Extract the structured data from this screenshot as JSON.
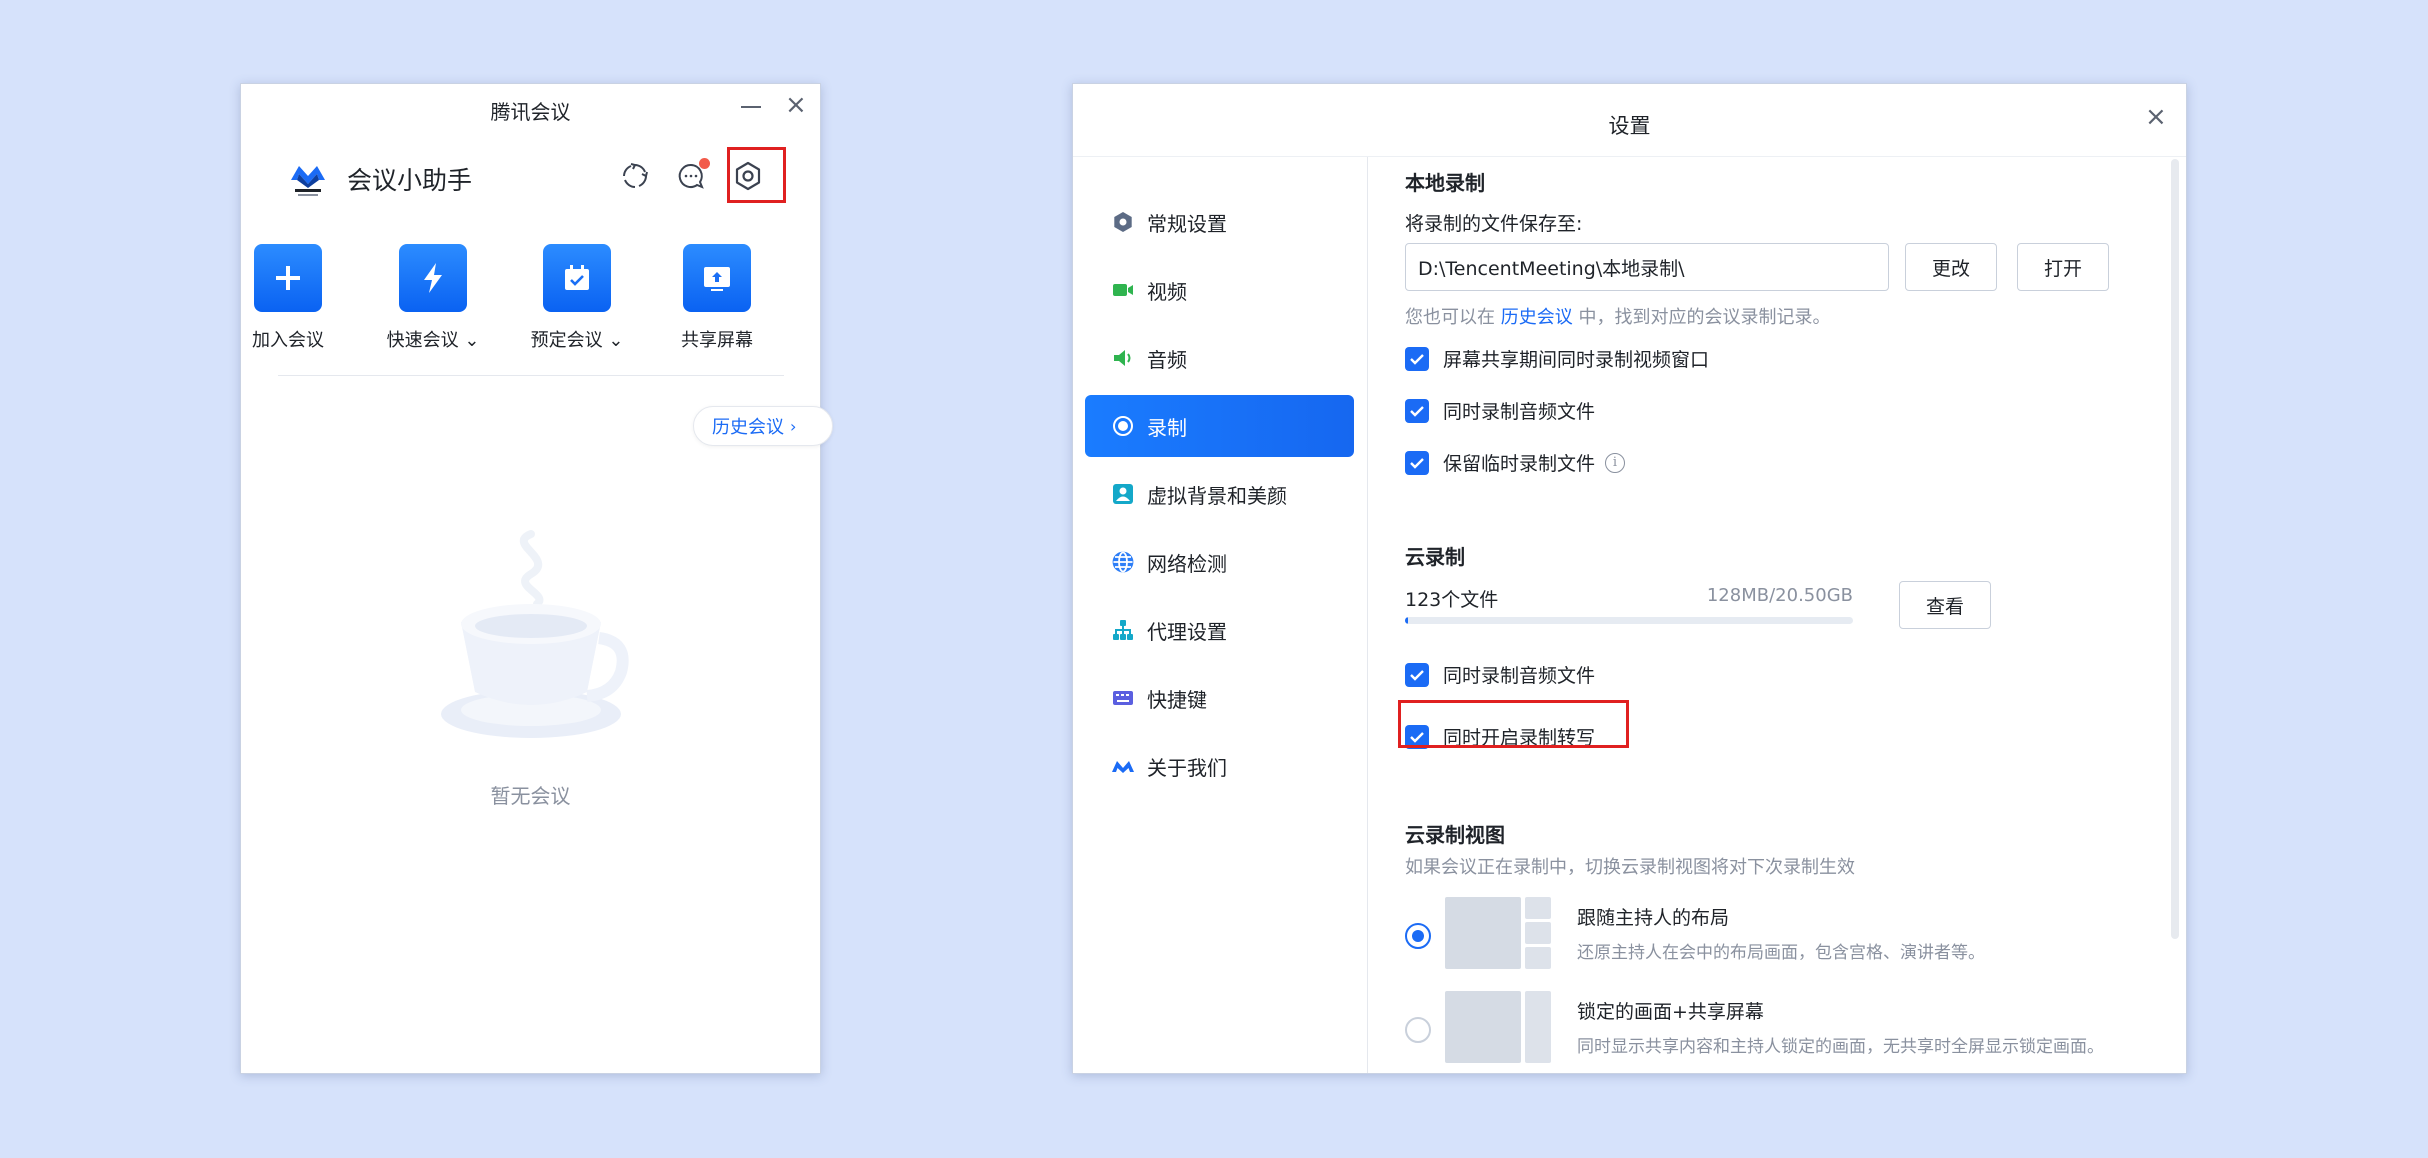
{
  "main_window": {
    "title": "腾讯会议",
    "brand_name": "会议小助手",
    "actions": [
      {
        "label": "加入会议",
        "icon": "plus-icon"
      },
      {
        "label": "快速会议",
        "icon": "lightning-icon",
        "dropdown": true
      },
      {
        "label": "预定会议",
        "icon": "calendar-icon",
        "dropdown": true
      },
      {
        "label": "共享屏幕",
        "icon": "share-screen-icon"
      }
    ],
    "history_button": "历史会议",
    "empty_text": "暂无会议"
  },
  "settings_window": {
    "title": "设置",
    "nav": [
      {
        "label": "常规设置",
        "icon": "gear-icon"
      },
      {
        "label": "视频",
        "icon": "camera-icon"
      },
      {
        "label": "音频",
        "icon": "speaker-icon"
      },
      {
        "label": "录制",
        "icon": "record-icon",
        "active": true
      },
      {
        "label": "虚拟背景和美颜",
        "icon": "portrait-icon"
      },
      {
        "label": "网络检测",
        "icon": "globe-icon"
      },
      {
        "label": "代理设置",
        "icon": "network-icon"
      },
      {
        "label": "快捷键",
        "icon": "keyboard-icon"
      },
      {
        "label": "关于我们",
        "icon": "tencent-meeting-logo-icon"
      }
    ],
    "local": {
      "title": "本地录制",
      "save_label": "将录制的文件保存至:",
      "path": "D:\\TencentMeeting\\本地录制\\",
      "change_button": "更改",
      "open_button": "打开",
      "hint_prefix": "您也可以在",
      "hint_link": "历史会议",
      "hint_suffix": "中，找到对应的会议录制记录。",
      "options": [
        "屏幕共享期间同时录制视频窗口",
        "同时录制音频文件",
        "保留临时录制文件"
      ]
    },
    "cloud": {
      "title": "云录制",
      "file_count": "123个文件",
      "usage": "128MB/20.50GB",
      "usage_fraction": 0.006,
      "view_button": "查看",
      "options": [
        "同时录制音频文件",
        "同时开启录制转写"
      ]
    },
    "cloud_view": {
      "title": "云录制视图",
      "desc": "如果会议正在录制中，切换云录制视图将对下次录制生效",
      "options": [
        {
          "title": "跟随主持人的布局",
          "desc": "还原主持人在会中的布局画面，包含宫格、演讲者等。",
          "selected": true
        },
        {
          "title": "锁定的画面+共享屏幕",
          "desc": "同时显示共享内容和主持人锁定的画面，无共享时全屏显示锁定画面。",
          "selected": false
        }
      ]
    }
  },
  "colors": {
    "accent": "#1b6bf5",
    "highlight_box": "#e02020",
    "background": "#d6e2fb"
  }
}
